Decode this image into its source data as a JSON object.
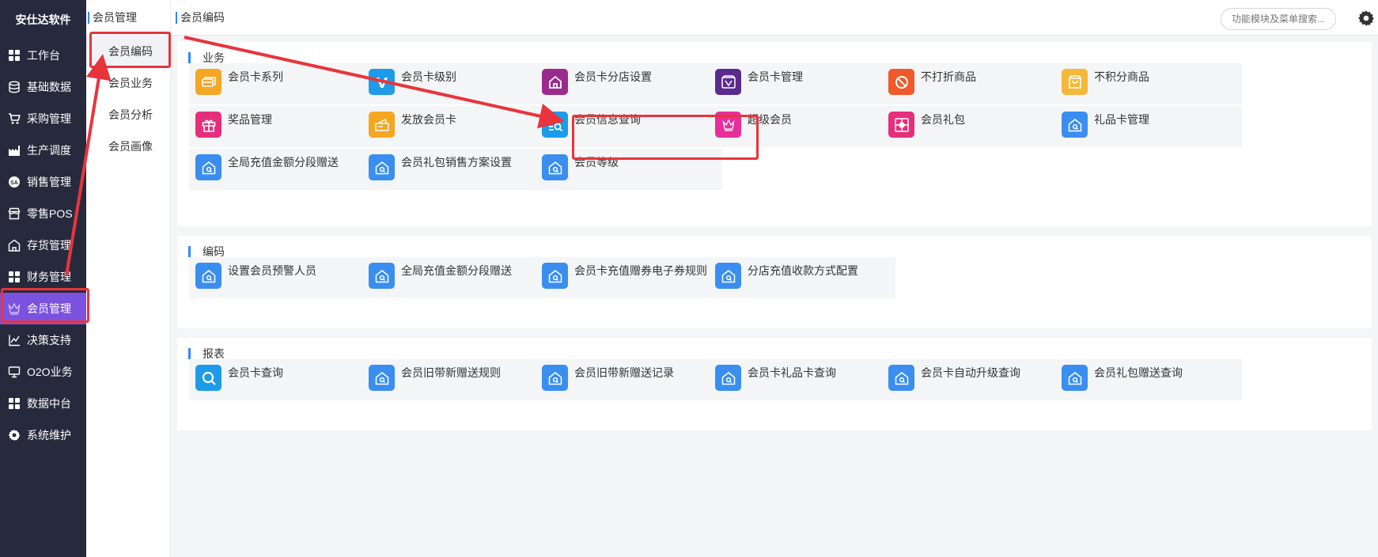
{
  "brand": "安仕达软件",
  "nav": [
    {
      "label": "工作台",
      "icon": "grid-icon"
    },
    {
      "label": "基础数据",
      "icon": "database-icon"
    },
    {
      "label": "采购管理",
      "icon": "cart-icon"
    },
    {
      "label": "生产调度",
      "icon": "factory-icon"
    },
    {
      "label": "销售管理",
      "icon": "sales-icon"
    },
    {
      "label": "零售POS",
      "icon": "store-icon"
    },
    {
      "label": "存货管理",
      "icon": "warehouse-icon"
    },
    {
      "label": "财务管理",
      "icon": "grid-icon"
    },
    {
      "label": "会员管理",
      "icon": "crown-icon",
      "active": true
    },
    {
      "label": "决策支持",
      "icon": "chart-icon"
    },
    {
      "label": "O2O业务",
      "icon": "monitor-icon"
    },
    {
      "label": "数据中台",
      "icon": "grid-icon"
    },
    {
      "label": "系统维护",
      "icon": "gear-icon"
    }
  ],
  "submenu": {
    "title": "会员管理",
    "items": [
      "会员编码",
      "会员业务",
      "会员分析",
      "会员画像"
    ]
  },
  "topbar": {
    "breadcrumb": "会员编码",
    "search_placeholder": "功能模块及菜单搜索..."
  },
  "sections": [
    {
      "title": "业务",
      "tiles": [
        {
          "label": "会员卡系列",
          "icon": "card-series-icon",
          "color": "#f5a623"
        },
        {
          "label": "会员卡级别",
          "icon": "vip-level-icon",
          "color": "#1e9be8"
        },
        {
          "label": "会员卡分店设置",
          "icon": "store-setting-icon",
          "color": "#9b2a8e"
        },
        {
          "label": "会员卡管理",
          "icon": "vip-card-icon",
          "color": "#5b2a8e"
        },
        {
          "label": "不打折商品",
          "icon": "no-discount-icon",
          "color": "#f0592a"
        },
        {
          "label": "不积分商品",
          "icon": "bag-icon",
          "color": "#f5b83a"
        },
        {
          "label": "奖品管理",
          "icon": "gift-icon",
          "color": "#e62f7c"
        },
        {
          "label": "发放会员卡",
          "icon": "issue-card-icon",
          "color": "#f5a623"
        },
        {
          "label": "会员信息查询",
          "icon": "member-search-icon",
          "color": "#1e9be8"
        },
        {
          "label": "超级会员",
          "icon": "crown-icon",
          "color": "#e62f9c"
        },
        {
          "label": "会员礼包",
          "icon": "gift-pack-icon",
          "color": "#e62f7c"
        },
        {
          "label": "礼品卡管理",
          "icon": "home-search-icon",
          "color": "#3a8ef0"
        },
        {
          "label": "全局充值金额分段赠送",
          "icon": "home-search-icon",
          "color": "#3a8ef0"
        },
        {
          "label": "会员礼包销售方案设置",
          "icon": "home-search-icon",
          "color": "#3a8ef0"
        },
        {
          "label": "会员等级",
          "icon": "home-search-icon",
          "color": "#3a8ef0"
        }
      ]
    },
    {
      "title": "编码",
      "tiles": [
        {
          "label": "设置会员预警人员",
          "icon": "home-search-icon",
          "color": "#3a8ef0"
        },
        {
          "label": "全局充值金额分段赠送",
          "icon": "home-search-icon",
          "color": "#3a8ef0"
        },
        {
          "label": "会员卡充值赠券电子券规则",
          "icon": "home-search-icon",
          "color": "#3a8ef0"
        },
        {
          "label": "分店充值收款方式配置",
          "icon": "home-search-icon",
          "color": "#3a8ef0"
        }
      ]
    },
    {
      "title": "报表",
      "tiles": [
        {
          "label": "会员卡查询",
          "icon": "search-icon",
          "color": "#1e9be8"
        },
        {
          "label": "会员旧带新赠送规则",
          "icon": "home-search-icon",
          "color": "#3a8ef0"
        },
        {
          "label": "会员旧带新赠送记录",
          "icon": "home-search-icon",
          "color": "#3a8ef0"
        },
        {
          "label": "会员卡礼品卡查询",
          "icon": "home-search-icon",
          "color": "#3a8ef0"
        },
        {
          "label": "会员卡自动升级查询",
          "icon": "home-search-icon",
          "color": "#3a8ef0"
        },
        {
          "label": "会员礼包赠送查询",
          "icon": "home-search-icon",
          "color": "#3a8ef0"
        }
      ]
    }
  ]
}
